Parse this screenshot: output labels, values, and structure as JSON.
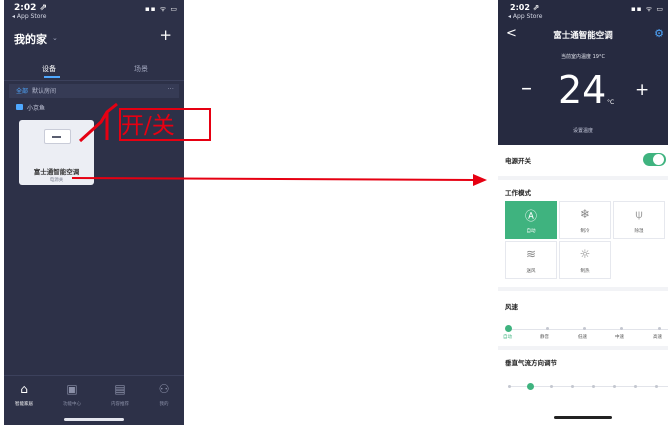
{
  "left": {
    "status": {
      "time": "2:02 ⇗",
      "back_app": "◂ App Store",
      "icons": "▪▪ ᯤ ▭"
    },
    "home_title": "我的家",
    "add_label": "+",
    "tabs": {
      "devices": "设备",
      "scenes": "场景"
    },
    "filters": {
      "all": "全部",
      "room": "默认房间",
      "more": "···"
    },
    "room_label": "小京鱼",
    "device": {
      "name": "富士通智能空调",
      "status": "电源关"
    },
    "nav": [
      {
        "icon": "⌂",
        "label": "智能家居"
      },
      {
        "icon": "▣",
        "label": "功能中心"
      },
      {
        "icon": "▤",
        "label": "内容推荐"
      },
      {
        "icon": "⚇",
        "label": "我的"
      }
    ],
    "colors": {
      "bg": "#2d3148",
      "accent": "#4fa8ff"
    }
  },
  "annotation": {
    "text": "开/关",
    "color": "#e60012"
  },
  "right": {
    "status": {
      "time": "2:02 ⇗",
      "back_app": "◂ App Store",
      "icons": "▪▪ ᯤ ▭"
    },
    "title": "富士通智能空调",
    "back": "<",
    "indoor_temp": "当前室内温度 19°C",
    "minus": "–",
    "set_temp": "24",
    "unit": "°C",
    "plus": "+",
    "set_label": "设置温度",
    "power": {
      "label": "电源开关",
      "on": true
    },
    "mode_label": "工作模式",
    "modes": [
      {
        "name": "自动",
        "icon": "Ⓐ",
        "active": true
      },
      {
        "name": "制冷",
        "icon": "❄",
        "active": false
      },
      {
        "name": "除湿",
        "icon": "⍦",
        "active": false
      },
      {
        "name": "送风",
        "icon": "≋",
        "active": false
      },
      {
        "name": "制热",
        "icon": "☼",
        "active": false
      }
    ],
    "fan_label": "风速",
    "fan_speeds": [
      "自动",
      "静音",
      "低速",
      "中速",
      "高速"
    ],
    "fan_selected": 0,
    "vertical_label": "垂直气流方向调节",
    "vertical_selected": 1,
    "colors": {
      "accent": "#3fb37f",
      "header": "#262a40"
    }
  }
}
